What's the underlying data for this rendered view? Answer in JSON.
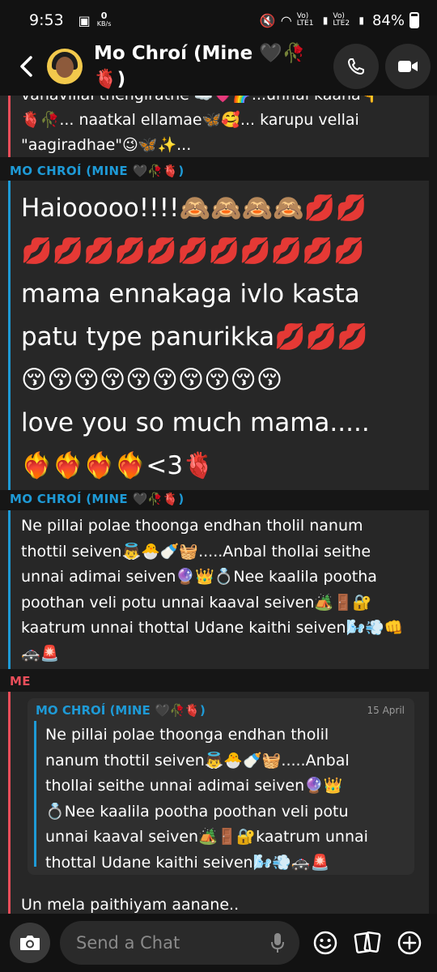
{
  "status": {
    "time": "9:53",
    "speed": "0",
    "speed_unit": "KB/s",
    "sim1": "Vo) LTE1",
    "sim2": "Vo) LTE2",
    "battery": "84%"
  },
  "header": {
    "title_line1": "Mo Chroí (Mine 🖤🥀",
    "title_line2": "🫀)"
  },
  "messages": [
    {
      "sender": "",
      "lines": [
        "vanavillai thengirathe ☁️💗🌈...unnai kaana👇",
        "🫀🥀... naatkal ellamae🦋🥰... karupu vellai",
        "\"aagiradhae\"😉🦋✨..."
      ]
    },
    {
      "sender": "MO CHROÍ (MINE 🖤🥀🫀)",
      "lines": [
        "Haiooooo!!!!🙈🙈🙈🙈💋💋",
        "💋💋💋💋💋💋💋💋💋💋💋",
        "mama ennakaga ivlo kasta",
        "patu type panurikka💋💋💋",
        "😚😚😚😚😚😚😚😚😚😚",
        "love you so much mama.....",
        "❤️‍🔥❤️‍🔥❤️‍🔥❤️‍🔥<3🫀"
      ]
    },
    {
      "sender": "MO CHROÍ (MINE 🖤🥀🫀)",
      "lines": [
        "Ne pillai polae thoonga endhan tholil nanum",
        "thottil seiven👼🐣🍼🧺.....Anbal thollai seithe",
        "unnai adimai seiven🔮👑💍Nee kaalila pootha",
        "poothan veli potu unnai kaaval seiven🏕️🚪🔐",
        "kaatrum unnai thottal Udane kaithi seiven🌬️💨👊",
        "🚓🚨"
      ]
    },
    {
      "sender": "ME",
      "quote_sender": "MO CHROÍ (MINE 🖤🥀🫀)",
      "quote_date": "15 April",
      "quote_lines": [
        "Ne pillai polae thoonga endhan tholil",
        "nanum thottil seiven👼🐣🍼🧺.....Anbal",
        "thollai seithe  unnai adimai seiven🔮👑",
        "💍Nee kaalila pootha poothan veli potu",
        "unnai kaaval seiven🏕️🚪🔐kaatrum unnai",
        "thottal Udane kaithi seiven🌬️💨🚓🚨"
      ],
      "reply": "Un mela paithiyam aanane.."
    }
  ],
  "composer": {
    "placeholder": "Send a Chat"
  },
  "colors": {
    "them": "#1e9ad6",
    "me": "#e94e5a",
    "bubble": "#272727"
  }
}
